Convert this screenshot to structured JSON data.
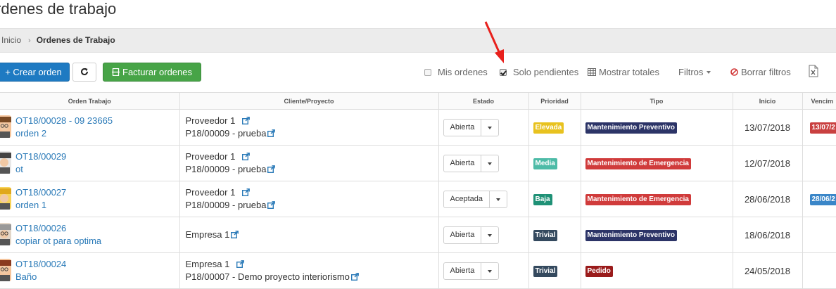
{
  "page": {
    "title": "rdenes de trabajo"
  },
  "breadcrumb": {
    "home": "Inicio",
    "separator": "›",
    "current": "Ordenes de Trabajo"
  },
  "toolbar": {
    "create_label": "+ Crear orden",
    "refresh_icon": "refresh-icon",
    "invoice_label": "Facturar ordenes",
    "mis_ordenes": {
      "label": "Mis ordenes",
      "checked": false
    },
    "solo_pendientes": {
      "label": "Solo pendientes",
      "checked": true
    },
    "mostrar_totales": "Mostrar totales",
    "filtros": "Filtros",
    "borrar_filtros": "Borrar filtros",
    "excel_icon": "excel-export-icon"
  },
  "colors": {
    "primary": "#1e7ac2",
    "success": "#47a447",
    "link": "#2a7ab8",
    "elevada": "#e8c21f",
    "media": "#4dbba7",
    "baja": "#1f9176",
    "trivial": "#34495e",
    "preventivo": "#2c3467",
    "emergencia": "#d03b3b",
    "pedido": "#9a1b1b",
    "venc_red": "#c94040",
    "venc_blue": "#3a86c8",
    "annotation_arrow": "#e8201c"
  },
  "table": {
    "headers": {
      "orden": "Orden Trabajo",
      "cliente": "Cliente/Proyecto",
      "estado": "Estado",
      "prioridad": "Prioridad",
      "tipo": "Tipo",
      "inicio": "Inicio",
      "vencimiento": "Vencim"
    },
    "rows": [
      {
        "code": "OT18/00028 - 09 23665",
        "name": "orden 2",
        "cliente": "Proveedor 1",
        "proyecto": "P18/00009 - prueba",
        "estado": "Abierta",
        "prioridad": "Elevada",
        "tipo": "Mantenimiento Preventivo",
        "inicio": "13/07/2018",
        "vencimiento": "13/07/2"
      },
      {
        "code": "OT18/00029",
        "name": "ot",
        "cliente": "Proveedor 1",
        "proyecto": "P18/00009 - prueba",
        "estado": "Abierta",
        "prioridad": "Media",
        "tipo": "Mantenimiento de Emergencia",
        "inicio": "12/07/2018",
        "vencimiento": ""
      },
      {
        "code": "OT18/00027",
        "name": "orden 1",
        "cliente": "Proveedor 1",
        "proyecto": "P18/00009 - prueba",
        "estado": "Aceptada",
        "prioridad": "Baja",
        "tipo": "Mantenimiento de Emergencia",
        "inicio": "28/06/2018",
        "vencimiento": "28/06/2"
      },
      {
        "code": "OT18/00026",
        "name": "copiar ot para optima",
        "cliente": "Empresa 1",
        "proyecto": "",
        "estado": "Abierta",
        "prioridad": "Trivial",
        "tipo": "Mantenimiento Preventivo",
        "inicio": "18/06/2018",
        "vencimiento": ""
      },
      {
        "code": "OT18/00024",
        "name": "Baño",
        "cliente": "Empresa 1",
        "proyecto": "P18/00007 - Demo proyecto interiorismo",
        "estado": "Abierta",
        "prioridad": "Trivial",
        "tipo": "Pedido",
        "inicio": "24/05/2018",
        "vencimiento": ""
      }
    ]
  }
}
